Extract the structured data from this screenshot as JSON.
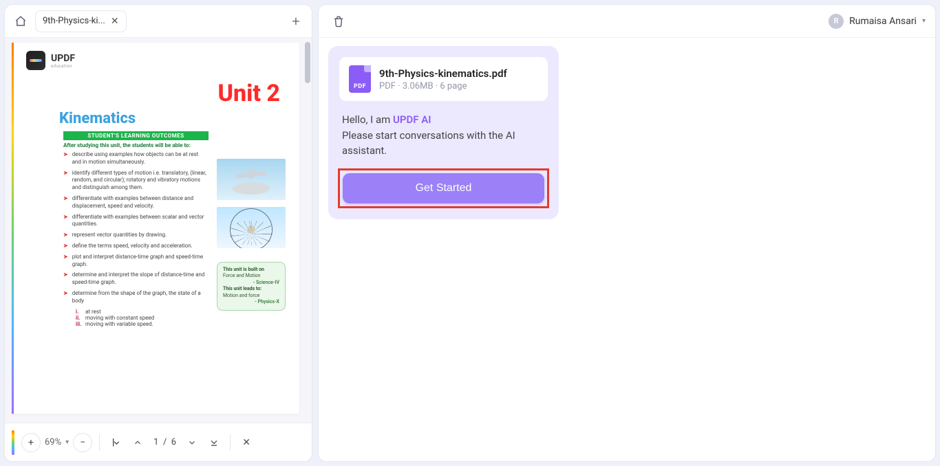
{
  "tabs": {
    "active_label": "9th-Physics-ki..."
  },
  "zoom": {
    "value": "69%"
  },
  "paging": {
    "current": "1",
    "total": "6",
    "sep": "/"
  },
  "user": {
    "initial": "R",
    "name": "Rumaisa Ansari"
  },
  "file": {
    "name": "9th-Physics-kinematics.pdf",
    "meta": "PDF · 3.06MB · 6 page",
    "badge": "PDF"
  },
  "intro": {
    "hello": "Hello, I am ",
    "ai_name": "UPDF AI",
    "line2": "Please start conversations with the AI assistant.",
    "cta": "Get Started"
  },
  "doc": {
    "brand_name": "UPDF",
    "brand_sub": "education",
    "unit": "Unit 2",
    "subject": "Kinematics",
    "outcomes_header": "STUDENT'S LEARNING OUTCOMES",
    "after": "After studying this unit, the students will be able to:",
    "bullets": [
      "describe using examples how objects can be at rest and in motion simultaneously.",
      "identify different types of motion i.e. translatory, (linear, random, and circular); rotatory and vibratory motions and distinguish among them.",
      "differentiate with examples between distance and displacement, speed and velocity.",
      "differentiate with examples between scalar and vector quantities.",
      "represent vector quantities by drawing.",
      "define the terms speed, velocity and acceleration.",
      "plot and interpret distance-time graph and speed-time graph.",
      "determine and interpret the slope of distance-time and speed-time graph.",
      "determine from the shape of the graph, the state of a body"
    ],
    "sub": [
      {
        "r": "i.",
        "t": "at rest"
      },
      {
        "r": "ii.",
        "t": "moving with constant speed"
      },
      {
        "r": "iii.",
        "t": "moving with variable speed."
      }
    ],
    "note": {
      "l1": "This unit is built on",
      "l2": "Force and Motion",
      "r1": "- Science-IV",
      "l3": "This unit leads to:",
      "l4": "Motion and force",
      "r2": "- Physics-X"
    }
  }
}
